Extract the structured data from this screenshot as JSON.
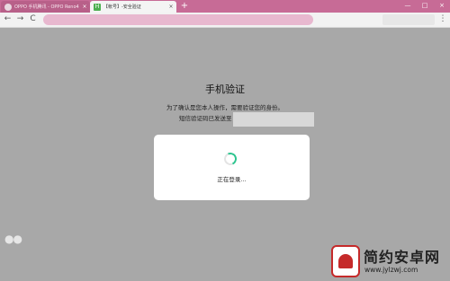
{
  "browser": {
    "tabs": [
      {
        "title": "OPPO 手机腾讯 - OPPO Reno4",
        "active": false,
        "close": "×"
      },
      {
        "title": "【帐号】-安全验证",
        "active": true,
        "close": "×",
        "favicon_letter": "H"
      }
    ],
    "new_tab": "+",
    "window_controls": {
      "minimize": "—",
      "maximize": "□",
      "close": "×"
    },
    "nav": {
      "back": "←",
      "forward": "→",
      "reload": "C",
      "menu": "⋮"
    }
  },
  "page": {
    "title": "手机验证",
    "description": "为了确认是您本人操作，需要验证您的身份。",
    "sms_label": "短信验证码已发送至"
  },
  "dialog": {
    "loading_text": "正在登录..."
  },
  "watermark": {
    "title": "简约安卓网",
    "url": "www.jylzwj.com"
  },
  "colors": {
    "tab_bar": "#c76b96",
    "accent_spinner": "#2dc58f",
    "overlay_bg": "#a8a8a8"
  }
}
